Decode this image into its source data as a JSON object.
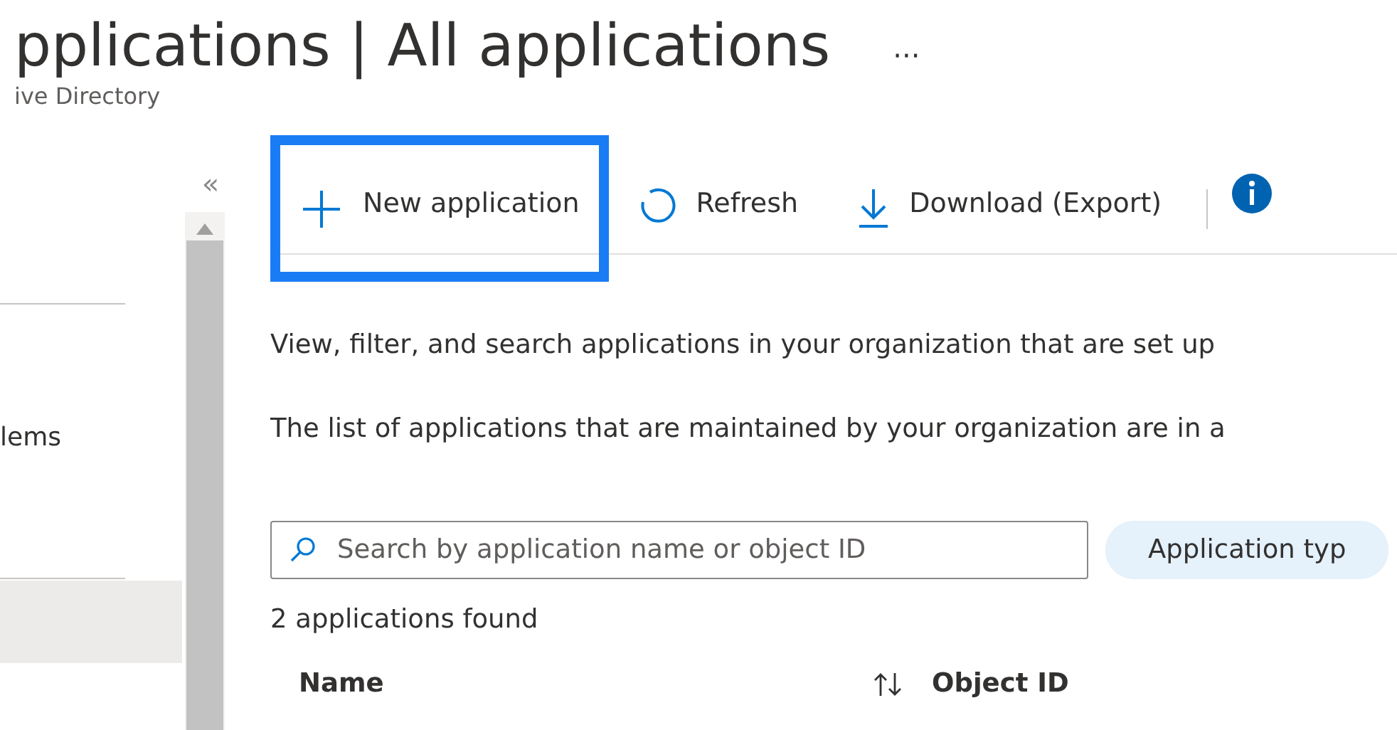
{
  "header": {
    "title": "pplications | All applications",
    "more": "···",
    "subtitle": "ive Directory"
  },
  "sidebar": {
    "collapse": "«",
    "items": [
      {
        "label": "lems"
      }
    ]
  },
  "toolbar": [
    {
      "kind": "add",
      "label": "New application",
      "highlighted": true
    },
    {
      "kind": "refresh",
      "label": "Refresh",
      "highlighted": false
    },
    {
      "kind": "download",
      "label": "Download (Export)",
      "highlighted": false
    },
    {
      "kind": "info",
      "highlighted": false
    }
  ],
  "description": [
    "View, filter, and search applications in your organization that are set up",
    "The list of applications that are maintained by your organization are in a"
  ],
  "search": {
    "placeholder": "Search by application name or object ID"
  },
  "filter": {
    "label": "Application typ"
  },
  "count": "2 applications found",
  "table": {
    "columns": [
      {
        "label": "Name",
        "sortable": true
      },
      {
        "label": "Object ID",
        "sortable": false
      }
    ]
  }
}
